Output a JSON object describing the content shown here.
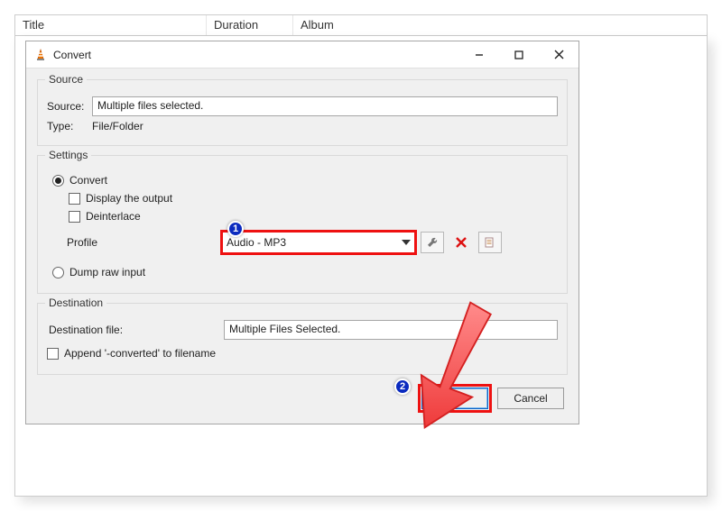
{
  "background_table": {
    "columns": [
      "Title",
      "Duration",
      "Album"
    ]
  },
  "dialog": {
    "title": "Convert",
    "source_group": {
      "legend": "Source",
      "source_label": "Source:",
      "source_value": "Multiple files selected.",
      "type_label": "Type:",
      "type_value": "File/Folder"
    },
    "settings_group": {
      "legend": "Settings",
      "convert_label": "Convert",
      "display_output_label": "Display the output",
      "deinterlace_label": "Deinterlace",
      "profile_label": "Profile",
      "profile_value": "Audio - MP3",
      "dump_raw_label": "Dump raw input"
    },
    "destination_group": {
      "legend": "Destination",
      "dest_file_label": "Destination file:",
      "dest_file_value": "Multiple Files Selected.",
      "append_label": "Append '-converted' to filename"
    },
    "buttons": {
      "start": "Start",
      "cancel": "Cancel"
    }
  },
  "annotations": {
    "badge1": "1",
    "badge2": "2"
  }
}
